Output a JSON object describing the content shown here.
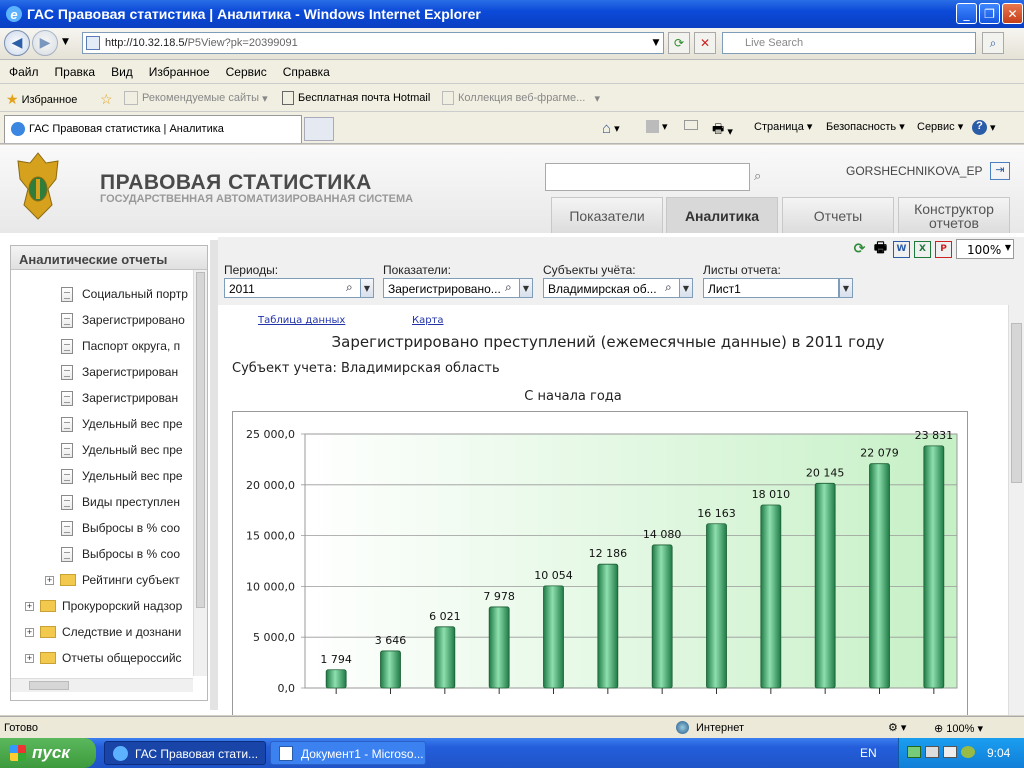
{
  "window": {
    "title": "ГАС Правовая статистика | Аналитика - Windows Internet Explorer"
  },
  "address": {
    "url_prefix": "http://10.32.18.5/",
    "url_suffix": "P5View?pk=20399091",
    "search_placeholder": "Live Search"
  },
  "menu": [
    "Файл",
    "Правка",
    "Вид",
    "Избранное",
    "Сервис",
    "Справка"
  ],
  "favbar": {
    "favorites": "Избранное",
    "recommended": "Рекомендуемые сайты",
    "hotmail": "Бесплатная почта Hotmail",
    "gallery": "Коллекция веб-фрагме..."
  },
  "browser_tab": {
    "title": "ГАС Правовая статистика | Аналитика"
  },
  "command_bar": {
    "page": "Страница",
    "safety": "Безопасность",
    "tools": "Сервис"
  },
  "site": {
    "title": "ПРАВОВАЯ СТАТИСТИКА",
    "subtitle": "ГОСУДАРСТВЕННАЯ АВТОМАТИЗИРОВАННАЯ СИСТЕМА",
    "user": "GORSHECHNIKOVA_EP",
    "tabs": [
      "Показатели",
      "Аналитика",
      "Отчеты",
      "Конструктор отчетов"
    ]
  },
  "sidebar": {
    "title": "Аналитические отчеты",
    "items": [
      "Социальный портр",
      "Зарегистрировано",
      "Паспорт округа, п",
      "Зарегистрирован",
      "Зарегистрирован",
      "Удельный вес пре",
      "Удельный вес пре",
      "Удельный вес пре",
      "Виды преступлен",
      "Выбросы в % соо",
      "Выбросы в % соо"
    ],
    "folders": [
      "Рейтинги субъект",
      "Прокурорский надзор",
      "Следствие и дознани",
      "Отчеты общероссийс"
    ]
  },
  "toolbar": {
    "zoom": "100%"
  },
  "filters": {
    "periods_label": "Периоды:",
    "periods_value": "2011",
    "indicators_label": "Показатели:",
    "indicators_value": "Зарегистрировано...",
    "subjects_label": "Субъекты учёта:",
    "subjects_value": "Владимирская об...",
    "sheets_label": "Листы отчета:",
    "sheets_value": "Лист1"
  },
  "report": {
    "link_table": "Таблица данных",
    "link_map": "Карта",
    "title": "Зарегистрировано преступлений (ежемесячные данные) в 2011 году",
    "subject": "Субъект учета: Владимирская область",
    "subtitle": "С начала года"
  },
  "chart_data": {
    "type": "bar",
    "title": "С начала года",
    "ylim": [
      0,
      25000
    ],
    "yticks": [
      "25 000,0",
      "20 000,0",
      "15 000,0",
      "10 000,0",
      "5 000,0",
      "0,0"
    ],
    "values": [
      1794,
      3646,
      6021,
      7978,
      10054,
      12186,
      14080,
      16163,
      18010,
      20145,
      22079,
      23831
    ],
    "labels": [
      "1 794",
      "3 646",
      "6 021",
      "7 978",
      "10 054",
      "12 186",
      "14 080",
      "16 163",
      "18 010",
      "20 145",
      "22 079",
      "23 831"
    ],
    "grid": true,
    "bar_color": "#3aa36a"
  },
  "statusbar": {
    "status": "Готово",
    "zone": "Интернет",
    "zoom": "100%"
  },
  "taskbar": {
    "start": "пуск",
    "task1": "ГАС Правовая стати...",
    "task2": "Документ1 - Microso...",
    "lang": "EN",
    "time": "9:04"
  }
}
